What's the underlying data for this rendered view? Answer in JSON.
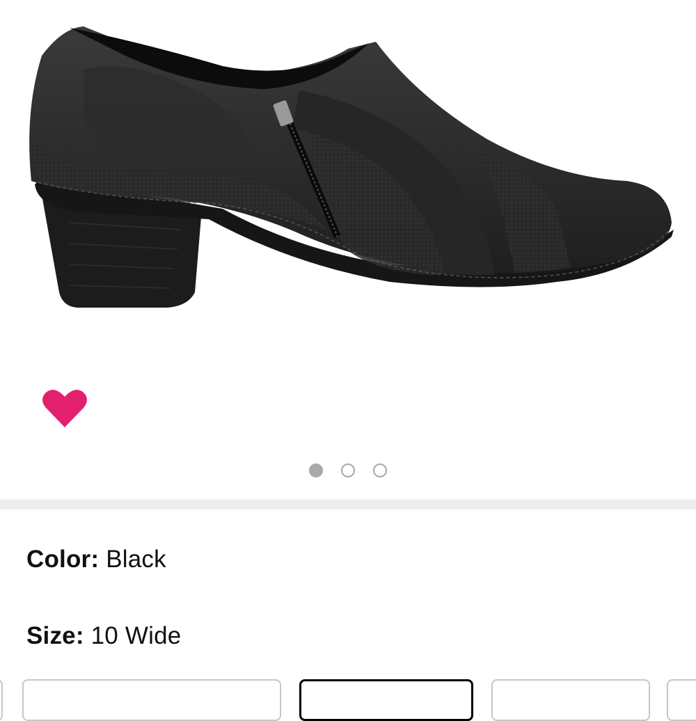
{
  "product": {
    "image_alt": "black leather side-zip heeled shootie",
    "favorite_icon": "heart-icon",
    "favorite_color": "#e3206d",
    "gallery_images_count": 3,
    "gallery_active_index": 0
  },
  "variations": {
    "color": {
      "label": "Color:",
      "value": "Black"
    },
    "size": {
      "label": "Size:",
      "value": "10 Wide"
    }
  },
  "size_swatches": {
    "count": 4,
    "selected_index": 1
  },
  "colors": {
    "accent_heart": "#e3206d",
    "dot_inactive": "#a9a9a9",
    "divider": "#eceded",
    "text": "#0f1111"
  }
}
